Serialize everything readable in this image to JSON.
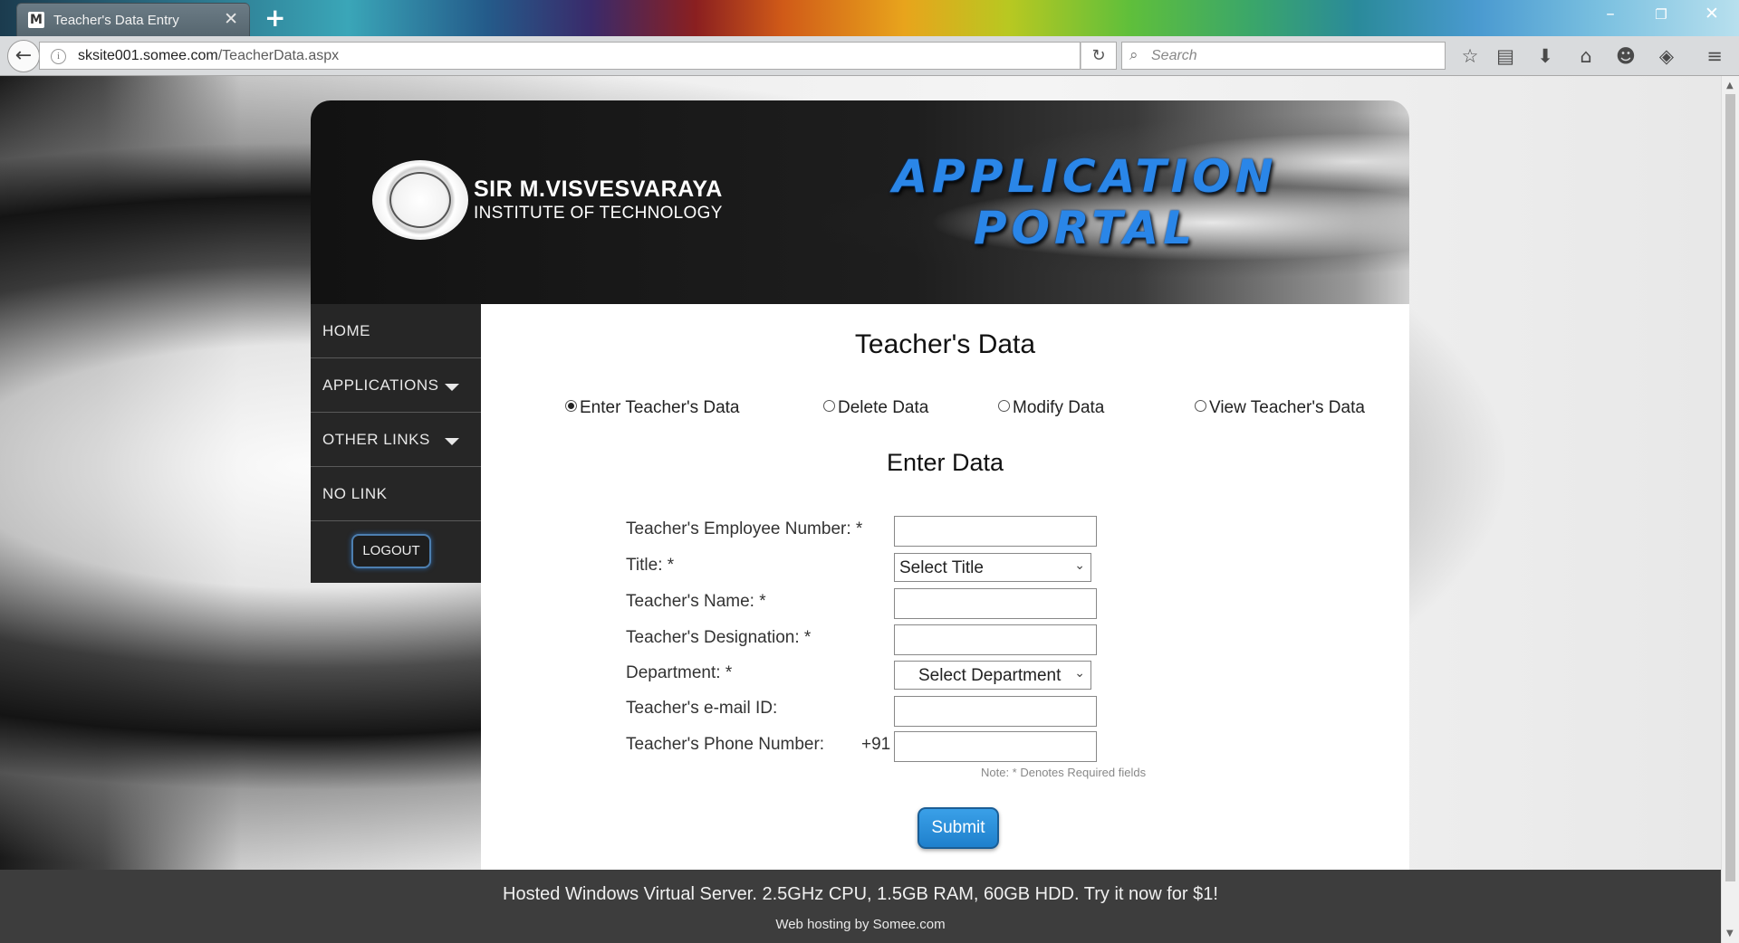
{
  "browser": {
    "tab_title": "Teacher's Data Entry",
    "favicon_letter": "M",
    "url_host": "sksite001.somee.com",
    "url_path": "/TeacherData.aspx",
    "search_placeholder": "Search"
  },
  "header": {
    "institute_line1": "SIR M.VISVESVARAYA",
    "institute_line2": "INSTITUTE OF TECHNOLOGY",
    "portal_line1": "APPLICATION",
    "portal_line2": "PORTAL"
  },
  "sidebar": {
    "items": [
      {
        "label": "HOME"
      },
      {
        "label": "APPLICATIONS"
      },
      {
        "label": "OTHER LINKS"
      },
      {
        "label": "NO LINK"
      }
    ],
    "logout_label": "LOGOUT"
  },
  "main": {
    "page_title": "Teacher's Data",
    "options": [
      {
        "label": "Enter Teacher's Data",
        "selected": true
      },
      {
        "label": "Delete Data",
        "selected": false
      },
      {
        "label": "Modify Data",
        "selected": false
      },
      {
        "label": "View Teacher's Data",
        "selected": false
      }
    ],
    "section_title": "Enter Data",
    "form": {
      "employee_number_label": "Teacher's Employee Number: *",
      "employee_number_value": "",
      "title_label": "Title: *",
      "title_selected": "Select Title",
      "name_label": "Teacher's Name: *",
      "name_value": "",
      "designation_label": "Teacher's Designation: *",
      "designation_value": "",
      "department_label": "Department: *",
      "department_selected": "Select Department",
      "email_label": "Teacher's e-mail ID:",
      "email_value": "",
      "phone_label": "Teacher's Phone Number:",
      "phone_prefix": "+91",
      "phone_value": ""
    },
    "note": "Note: * Denotes Required fields",
    "submit_label": "Submit"
  },
  "footer": {
    "ad_line1": "Hosted Windows Virtual Server. 2.5GHz CPU, 1.5GB RAM, 60GB HDD. Try it now for $1!",
    "ad_line2": "Web hosting by Somee.com"
  }
}
